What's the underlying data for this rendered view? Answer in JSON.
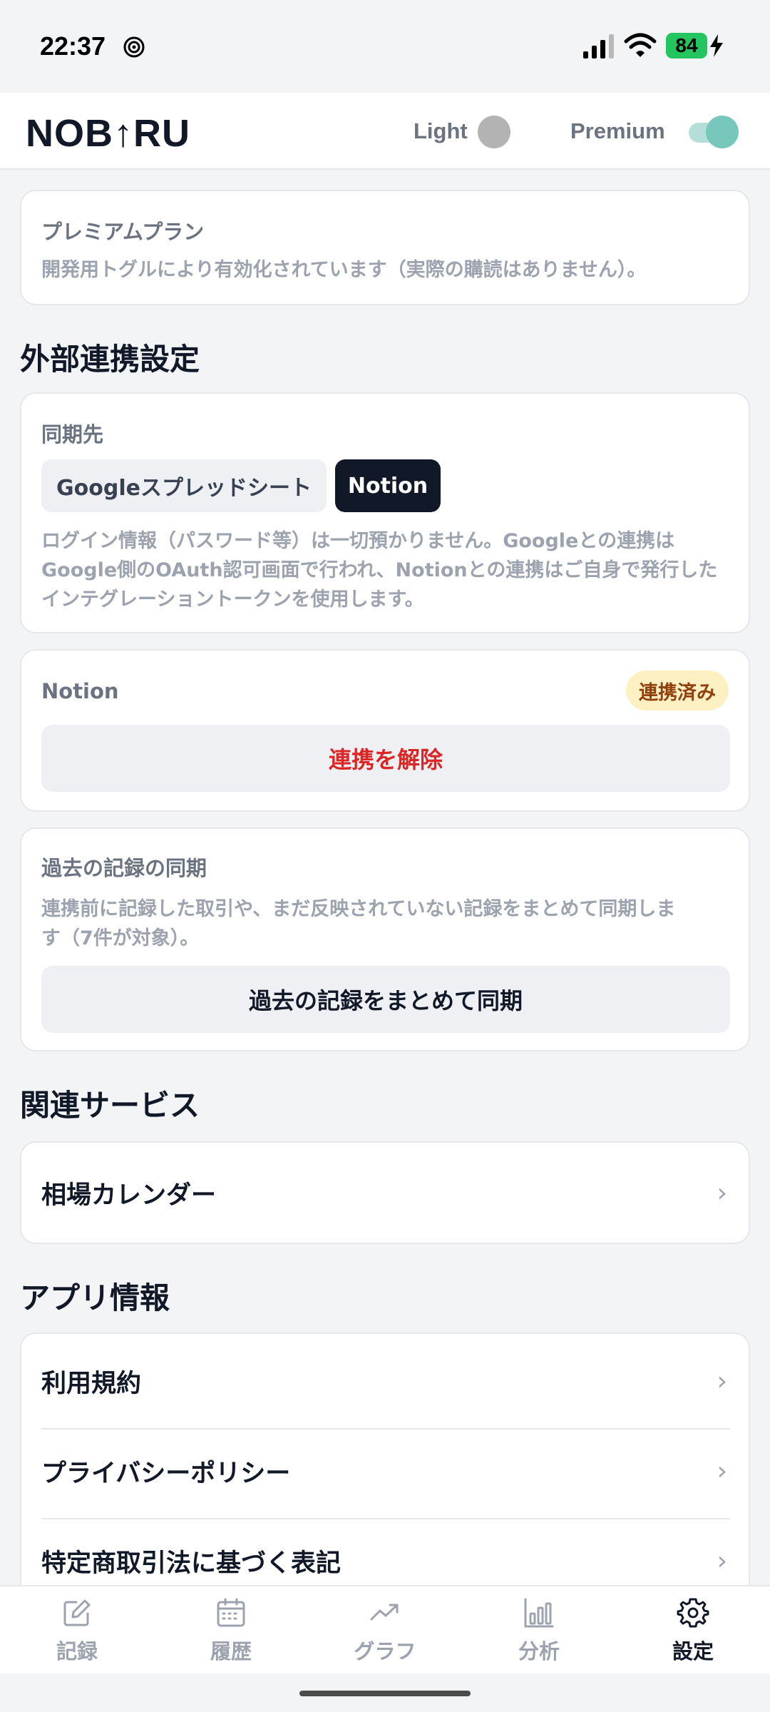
{
  "status_bar": {
    "time": "22:37",
    "battery": "84",
    "icons": [
      "focus-icon",
      "signal-icon",
      "wifi-icon",
      "battery-icon",
      "charging-bolt-icon"
    ]
  },
  "header": {
    "logo": "NOB↑RU",
    "light_label": "Light",
    "light_on": false,
    "premium_label": "Premium",
    "premium_on": true,
    "accent": "#77c7bd"
  },
  "premium_card": {
    "title": "プレミアムプラン",
    "description": "開発用トグルにより有効化されています（実際の購読はありません）。"
  },
  "integration": {
    "section_title": "外部連携設定",
    "sync_target_label": "同期先",
    "options": [
      "Googleスプレッドシート",
      "Notion"
    ],
    "selected": "Notion",
    "note_lines": [
      "ログイン情報（パスワード等）は一切預かりません。Googleとの連携は",
      "Google側のOAuth認可画面で行われ、Notionとの連携はご自身で発行した",
      "インテグレーショントークンを使用します。"
    ]
  },
  "notion_card": {
    "title": "Notion",
    "badge": "連携済み",
    "disconnect_label": "連携を解除",
    "danger_color": "#dc2626"
  },
  "past_sync": {
    "title": "過去の記録の同期",
    "desc_lines": [
      "連携前に記録した取引や、まだ反映されていない記録をまとめて同期しま",
      "す（7件が対象）。"
    ],
    "button_label": "過去の記録をまとめて同期"
  },
  "related": {
    "section_title": "関連サービス",
    "items": [
      "相場カレンダー"
    ]
  },
  "app_info": {
    "section_title": "アプリ情報",
    "items": [
      "利用規約",
      "プライバシーポリシー",
      "特定商取引法に基づく表記"
    ]
  },
  "chevron": "›",
  "nav": {
    "items": [
      {
        "label": "記録",
        "icon": "edit-icon"
      },
      {
        "label": "履歴",
        "icon": "calendar-icon"
      },
      {
        "label": "グラフ",
        "icon": "trend-icon"
      },
      {
        "label": "分析",
        "icon": "bar-chart-icon"
      },
      {
        "label": "設定",
        "icon": "gear-icon"
      }
    ],
    "active": "設定"
  }
}
